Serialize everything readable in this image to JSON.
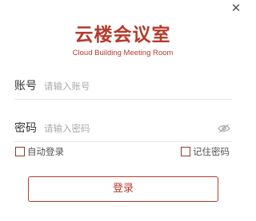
{
  "window": {
    "close_icon": "close-icon"
  },
  "brand": {
    "title": "云楼会议室",
    "subtitle": "Cloud Building Meeting Room",
    "color": "#b53a2a"
  },
  "form": {
    "account": {
      "label": "账号",
      "placeholder": "请输入账号",
      "value": ""
    },
    "password": {
      "label": "密码",
      "placeholder": "请输入密码",
      "value": "",
      "toggle_icon": "eye-off-icon"
    },
    "auto_login": {
      "label": "自动登录",
      "checked": false
    },
    "remember_password": {
      "label": "记住密码",
      "checked": false
    },
    "submit_label": "登录"
  },
  "colors": {
    "accent": "#b53a2a",
    "text": "#333333",
    "placeholder": "#aaaaaa",
    "divider": "#e6e6e6"
  }
}
